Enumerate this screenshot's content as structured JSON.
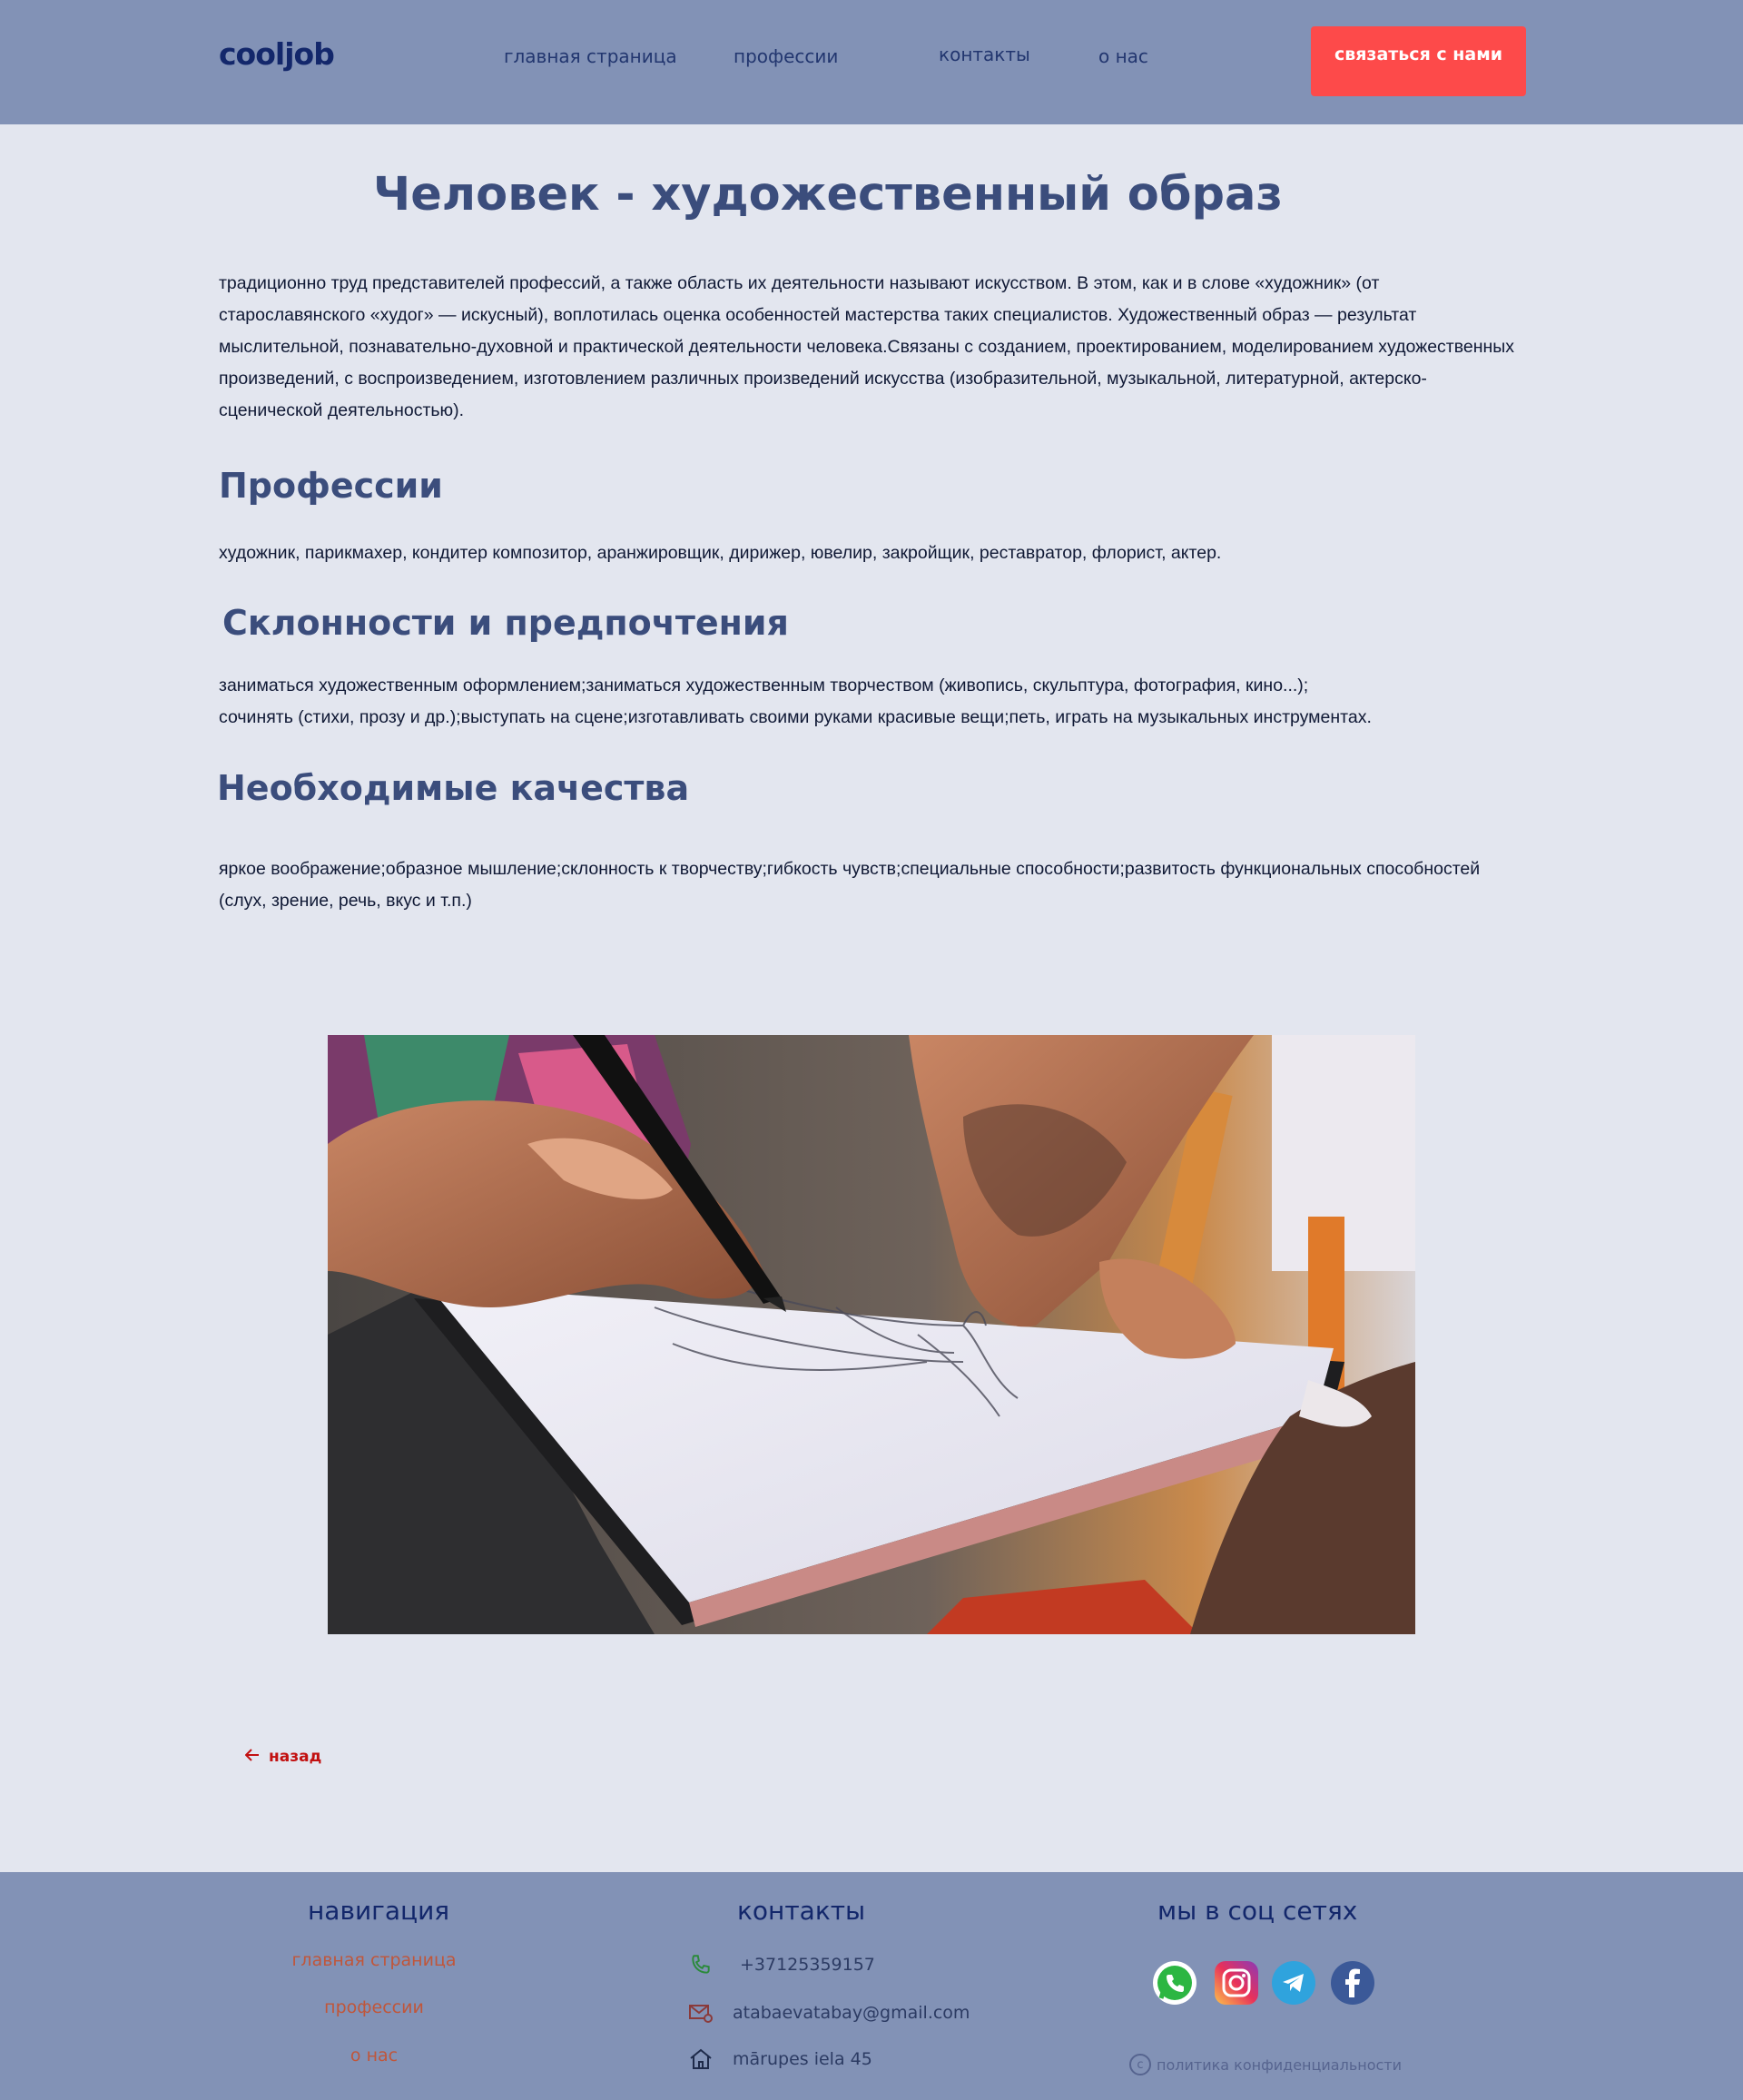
{
  "header": {
    "logo": "cooljob",
    "nav": [
      "главная страница",
      "профессии",
      "контакты",
      "о нас"
    ],
    "cta_label": "связаться с нами"
  },
  "main": {
    "title": "Человек - художественный образ",
    "intro": "традиционно труд представителей профессий, а также область их деятельности называют искусством. В этом, как и в слове «художник» (от старославянского «худог» — искусный), воплотилась оценка особенностей мастерства таких специалистов. Художественный образ — результат мыслительной, познавательно-духовной и практической деятельности человека.Связаны с созданием, проектированием, моделированием художественных произведений, с воспроизведением, изготовлением различных произведений искусства (изобразительной, музыкальной, литературной, актерско-сценической деятельностью).",
    "sections": [
      {
        "heading": "Профессии",
        "text": "художник, парикмахер, кондитер композитор, аранжировщик, дирижер, ювелир, закройщик, реставратор, флорист, актер."
      },
      {
        "heading": "Склонности и предпочтения",
        "text_lines": [
          "заниматься художественным оформлением;заниматься художественным творчеством (живопись, скульптура, фотография, кино...);",
          "сочинять (стихи, прозу и др.);выступать на сцене;изготавливать своими руками красивые вещи;петь, играть на музыкальных инструментах."
        ]
      },
      {
        "heading": "Необходимые качества",
        "text": "яркое воображение;образное мышление;склонность к творчеству;гибкость чувств;специальные способности;развитость функциональных способностей (слух, зрение, речь, вкус и т.п.)"
      }
    ],
    "back_label": "назад"
  },
  "footer": {
    "nav_heading": "навигация",
    "nav_links": [
      "главная страница",
      "профессии",
      "о нас"
    ],
    "contacts_heading": "контакты",
    "phone": "+37125359157",
    "email": "atabaevatabay@gmail.com",
    "address": "mārupes iela 45",
    "social_heading": "мы в соц сетях",
    "social_icons": [
      "whatsapp-icon",
      "instagram-icon",
      "telegram-icon",
      "facebook-icon"
    ],
    "privacy_label": "политика конфиденциальности"
  },
  "colors": {
    "header_bg": "#8292b6",
    "page_bg": "#e3e6ef",
    "accent_button": "#fd4a4a",
    "heading": "#3b4d7c",
    "logo": "#13276b",
    "footer_link": "#c0563a",
    "back_link": "#c21010"
  }
}
